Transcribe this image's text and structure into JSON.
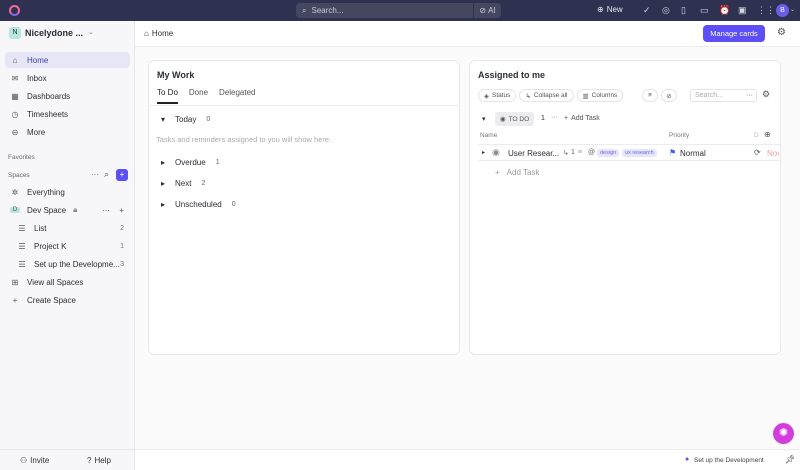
{
  "topbar": {
    "search_placeholder": "Search...",
    "ai_label": "AI",
    "new_label": "New",
    "avatar_initial": "B"
  },
  "sidebar": {
    "workspace_initial": "N",
    "workspace_name": "Nicelydone ...",
    "nav": [
      {
        "label": "Home",
        "icon": "home-icon"
      },
      {
        "label": "Inbox",
        "icon": "inbox-icon"
      },
      {
        "label": "Dashboards",
        "icon": "dashboard-icon"
      },
      {
        "label": "Timesheets",
        "icon": "clock-icon"
      },
      {
        "label": "More",
        "icon": "more-icon"
      }
    ],
    "favorites_label": "Favorites",
    "spaces_label": "Spaces",
    "everything_label": "Everything",
    "space": {
      "initial": "D",
      "name": "Dev Space"
    },
    "lists": [
      {
        "label": "List",
        "count": "2"
      },
      {
        "label": "Project K",
        "count": "1"
      },
      {
        "label": "Set up the Developme...",
        "count": "3"
      }
    ],
    "view_all_label": "View all Spaces",
    "create_space_label": "Create Space",
    "invite_label": "Invite",
    "help_label": "Help"
  },
  "header": {
    "breadcrumb": "Home",
    "manage_cards_label": "Manage cards"
  },
  "my_work": {
    "title": "My Work",
    "tabs": [
      "To Do",
      "Done",
      "Delegated"
    ],
    "empty_text": "Tasks and reminders assigned to you will show here.",
    "groups": [
      {
        "label": "Today",
        "count": "0"
      },
      {
        "label": "Overdue",
        "count": "1"
      },
      {
        "label": "Next",
        "count": "2"
      },
      {
        "label": "Unscheduled",
        "count": "0"
      }
    ]
  },
  "assigned": {
    "title": "Assigned to me",
    "status_label": "Status",
    "collapse_label": "Collapse all",
    "columns_label": "Columns",
    "search_placeholder": "Search...",
    "group_label": "TO DO",
    "group_count": "1",
    "add_task_label": "Add Task",
    "col_name": "Name",
    "col_priority": "Priority",
    "col_due": "D",
    "task": {
      "name": "User Resear...",
      "subtasks": "1",
      "tags": [
        "design",
        "ux research"
      ],
      "priority": "Normal",
      "due": "Nov"
    }
  },
  "footer": {
    "status_text": "Set up the Development"
  },
  "colors": {
    "accent": "#5b4ff5",
    "topbar": "#2f3150"
  }
}
